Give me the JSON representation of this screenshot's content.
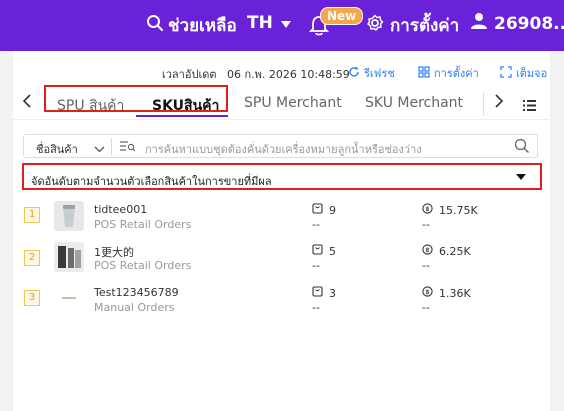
{
  "header": {
    "help_label": "ช่วยเหลือ",
    "language": "TH",
    "new_badge": "New",
    "settings_label": "การตั้งค่า",
    "user_id": "26908..."
  },
  "toolbar": {
    "update_label": "เวลาอัปเดต",
    "update_time": "06 ก.พ. 2026 10:48:59",
    "refresh_label": "รีเฟรช",
    "settings_label": "การตั้งค่า",
    "fullscreen_label": "เต็มจอ"
  },
  "tabs": [
    {
      "label": "SPU สินค้า"
    },
    {
      "label": "SKUสินค้า"
    },
    {
      "label": "SPU Merchant"
    },
    {
      "label": "SKU Merchant"
    }
  ],
  "search": {
    "field_label": "ชื่อสินค้า",
    "placeholder": "การค้นหาแบบชุดต้องคั่นด้วยเครื่องหมายลูกน้ำหรือช่องว่าง"
  },
  "sort": {
    "label": "จัดอันดับตามจำนวนตัวเลือกสินค้าในการขายที่มีผล"
  },
  "rows": [
    {
      "rank": "1",
      "name": "tidtee001",
      "source": "POS Retail Orders",
      "qty": "9",
      "qty_sub": "--",
      "amount": "15.75K",
      "amount_sub": "--"
    },
    {
      "rank": "2",
      "name": "1更大的",
      "source": "POS Retail Orders",
      "qty": "5",
      "qty_sub": "--",
      "amount": "6.25K",
      "amount_sub": "--"
    },
    {
      "rank": "3",
      "name": "Test123456789",
      "source": "Manual Orders",
      "qty": "3",
      "qty_sub": "--",
      "amount": "1.36K",
      "amount_sub": "--"
    }
  ],
  "colors": {
    "brand": "#6a22d8",
    "link": "#2d7ff0",
    "highlight": "#e0201a",
    "badge": "#f7a54a"
  }
}
